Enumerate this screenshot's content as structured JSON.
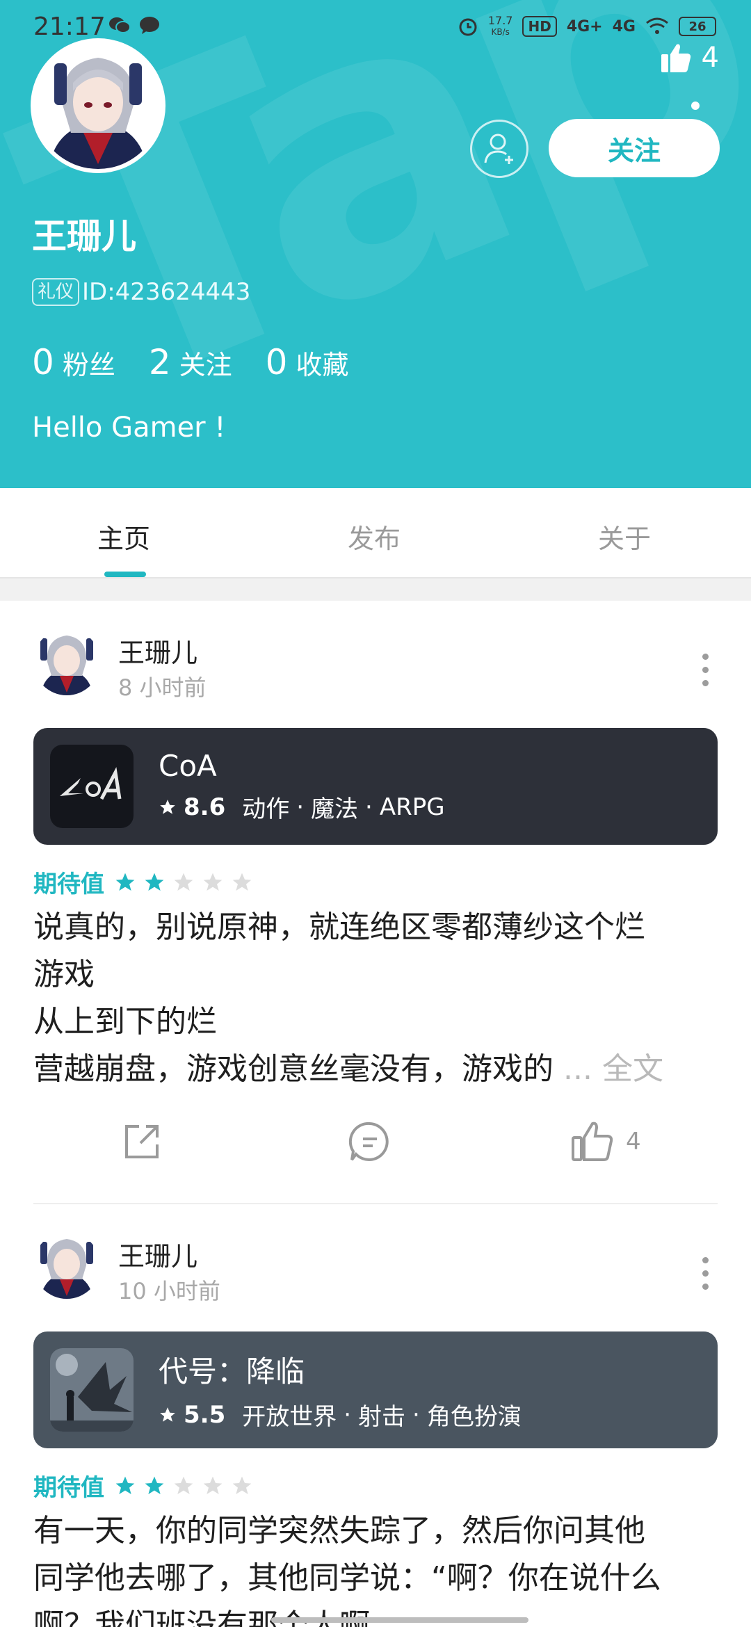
{
  "status_bar": {
    "time": "21:17",
    "net_speed_top": "17.7",
    "net_speed_unit": "KB/s",
    "hd_label": "HD",
    "sig1": "4G+",
    "sig2": "4G",
    "battery": "26"
  },
  "header": {
    "like_count": "4",
    "follow_label": "关注",
    "name": "王珊儿",
    "badge": "礼仪",
    "id_text": "ID:423624443",
    "stats": [
      {
        "num": "0",
        "label": "粉丝"
      },
      {
        "num": "2",
        "label": "关注"
      },
      {
        "num": "0",
        "label": "收藏"
      }
    ],
    "bio": "Hello Gamer !",
    "accent": "#2cbfc9"
  },
  "tabs": [
    {
      "label": "主页",
      "active": true
    },
    {
      "label": "发布",
      "active": false
    },
    {
      "label": "关于",
      "active": false
    }
  ],
  "posts": [
    {
      "user": "王珊儿",
      "time": "8 小时前",
      "game": {
        "name": "CoA",
        "score": "8.6",
        "tags": [
          "动作",
          "魔法",
          "ARPG"
        ],
        "bg": "#2d3039"
      },
      "expect_label": "期待值",
      "rating": 2,
      "body_lines": [
        "说真的，别说原神，就连绝区零都薄纱这个烂",
        "游戏",
        "从上到下的烂",
        "营越崩盘，游戏创意丝毫没有，游戏的"
      ],
      "ellipsis": "...",
      "fulltext": "全文",
      "like_count": "4"
    },
    {
      "user": "王珊儿",
      "time": "10 小时前",
      "game": {
        "name": "代号：降临",
        "score": "5.5",
        "tags": [
          "开放世界",
          "射击",
          "角色扮演"
        ],
        "bg": "#4a5560"
      },
      "expect_label": "期待值",
      "rating": 2,
      "body_lines": [
        "有一天，你的同学突然失踪了，然后你问其他",
        "同学他去哪了，其他同学说：“啊？你在说什么",
        "啊？我们班没有那个人啊"
      ]
    }
  ]
}
